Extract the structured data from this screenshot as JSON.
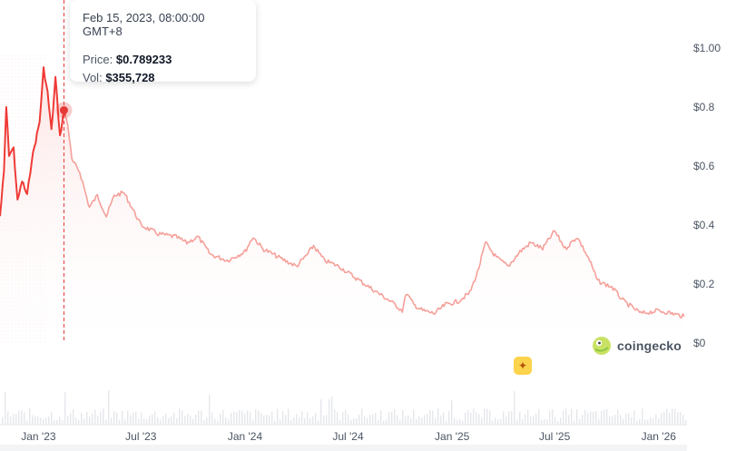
{
  "tooltip": {
    "date": "Feb 15, 2023, 08:00:00 GMT+8",
    "price_label": "Price:",
    "price_value": "$0.789233",
    "vol_label": "Vol:",
    "vol_value": "$355,728"
  },
  "brand": {
    "name": "coingecko",
    "logo_icon": "gecko-logo-icon"
  },
  "badge": {
    "icon": "sparkle-icon",
    "color": "#fcd34d"
  },
  "colors": {
    "highlight_line": "#ef3b36",
    "line": "#f5a09a",
    "fill": "#fde8e8",
    "crosshair": "#e53935",
    "volume": "#e5e7eb"
  },
  "chart_data": {
    "type": "area",
    "x_axis": {
      "min": "2022-10-25",
      "max": "2026-02-20",
      "ticks": [
        "Jan '23",
        "Jul '23",
        "Jan '24",
        "Jul '24",
        "Jan '25",
        "Jul '25",
        "Jan '26"
      ]
    },
    "y_axis": {
      "min": 0,
      "max": 1.0,
      "ticks": [
        "$0",
        "$0.2",
        "$0.4",
        "$0.6",
        "$0.8",
        "$1.00"
      ],
      "position": "right"
    },
    "hover": {
      "x": "2023-02-15",
      "y": 0.789233
    },
    "grid": false,
    "series": [
      {
        "points": [
          [
            "2022-10-25",
            0.43
          ],
          [
            "2022-11-01",
            0.58
          ],
          [
            "2022-11-05",
            0.8
          ],
          [
            "2022-11-10",
            0.64
          ],
          [
            "2022-11-18",
            0.66
          ],
          [
            "2022-11-25",
            0.48
          ],
          [
            "2022-12-03",
            0.55
          ],
          [
            "2022-12-12",
            0.5
          ],
          [
            "2022-12-20",
            0.62
          ],
          [
            "2023-01-03",
            0.75
          ],
          [
            "2023-01-10",
            0.93
          ],
          [
            "2023-01-17",
            0.85
          ],
          [
            "2023-01-24",
            0.72
          ],
          [
            "2023-01-31",
            0.9
          ],
          [
            "2023-02-08",
            0.7
          ],
          [
            "2023-02-15",
            0.789
          ],
          [
            "2023-02-22",
            0.74
          ],
          [
            "2023-03-01",
            0.62
          ],
          [
            "2023-03-15",
            0.58
          ],
          [
            "2023-04-01",
            0.46
          ],
          [
            "2023-04-15",
            0.5
          ],
          [
            "2023-05-01",
            0.43
          ],
          [
            "2023-05-15",
            0.5
          ],
          [
            "2023-06-01",
            0.51
          ],
          [
            "2023-06-15",
            0.46
          ],
          [
            "2023-07-01",
            0.4
          ],
          [
            "2023-08-01",
            0.37
          ],
          [
            "2023-09-01",
            0.36
          ],
          [
            "2023-09-20",
            0.34
          ],
          [
            "2023-10-10",
            0.36
          ],
          [
            "2023-11-01",
            0.3
          ],
          [
            "2023-12-01",
            0.28
          ],
          [
            "2024-01-01",
            0.31
          ],
          [
            "2024-01-15",
            0.36
          ],
          [
            "2024-02-01",
            0.32
          ],
          [
            "2024-03-01",
            0.29
          ],
          [
            "2024-04-01",
            0.26
          ],
          [
            "2024-04-20",
            0.3
          ],
          [
            "2024-05-01",
            0.33
          ],
          [
            "2024-05-20",
            0.28
          ],
          [
            "2024-06-15",
            0.26
          ],
          [
            "2024-07-15",
            0.22
          ],
          [
            "2024-08-15",
            0.18
          ],
          [
            "2024-09-15",
            0.14
          ],
          [
            "2024-10-05",
            0.11
          ],
          [
            "2024-10-12",
            0.17
          ],
          [
            "2024-10-25",
            0.13
          ],
          [
            "2024-11-10",
            0.11
          ],
          [
            "2024-12-01",
            0.1
          ],
          [
            "2024-12-20",
            0.13
          ],
          [
            "2025-01-10",
            0.14
          ],
          [
            "2025-02-01",
            0.17
          ],
          [
            "2025-02-15",
            0.24
          ],
          [
            "2025-03-01",
            0.34
          ],
          [
            "2025-03-20",
            0.29
          ],
          [
            "2025-04-10",
            0.26
          ],
          [
            "2025-05-01",
            0.31
          ],
          [
            "2025-05-20",
            0.34
          ],
          [
            "2025-06-10",
            0.32
          ],
          [
            "2025-07-01",
            0.38
          ],
          [
            "2025-07-20",
            0.32
          ],
          [
            "2025-08-10",
            0.36
          ],
          [
            "2025-09-01",
            0.28
          ],
          [
            "2025-09-15",
            0.21
          ],
          [
            "2025-10-10",
            0.19
          ],
          [
            "2025-11-01",
            0.14
          ],
          [
            "2025-12-01",
            0.1
          ],
          [
            "2026-01-01",
            0.11
          ],
          [
            "2026-01-25",
            0.1
          ],
          [
            "2026-02-15",
            0.09
          ]
        ]
      }
    ]
  }
}
